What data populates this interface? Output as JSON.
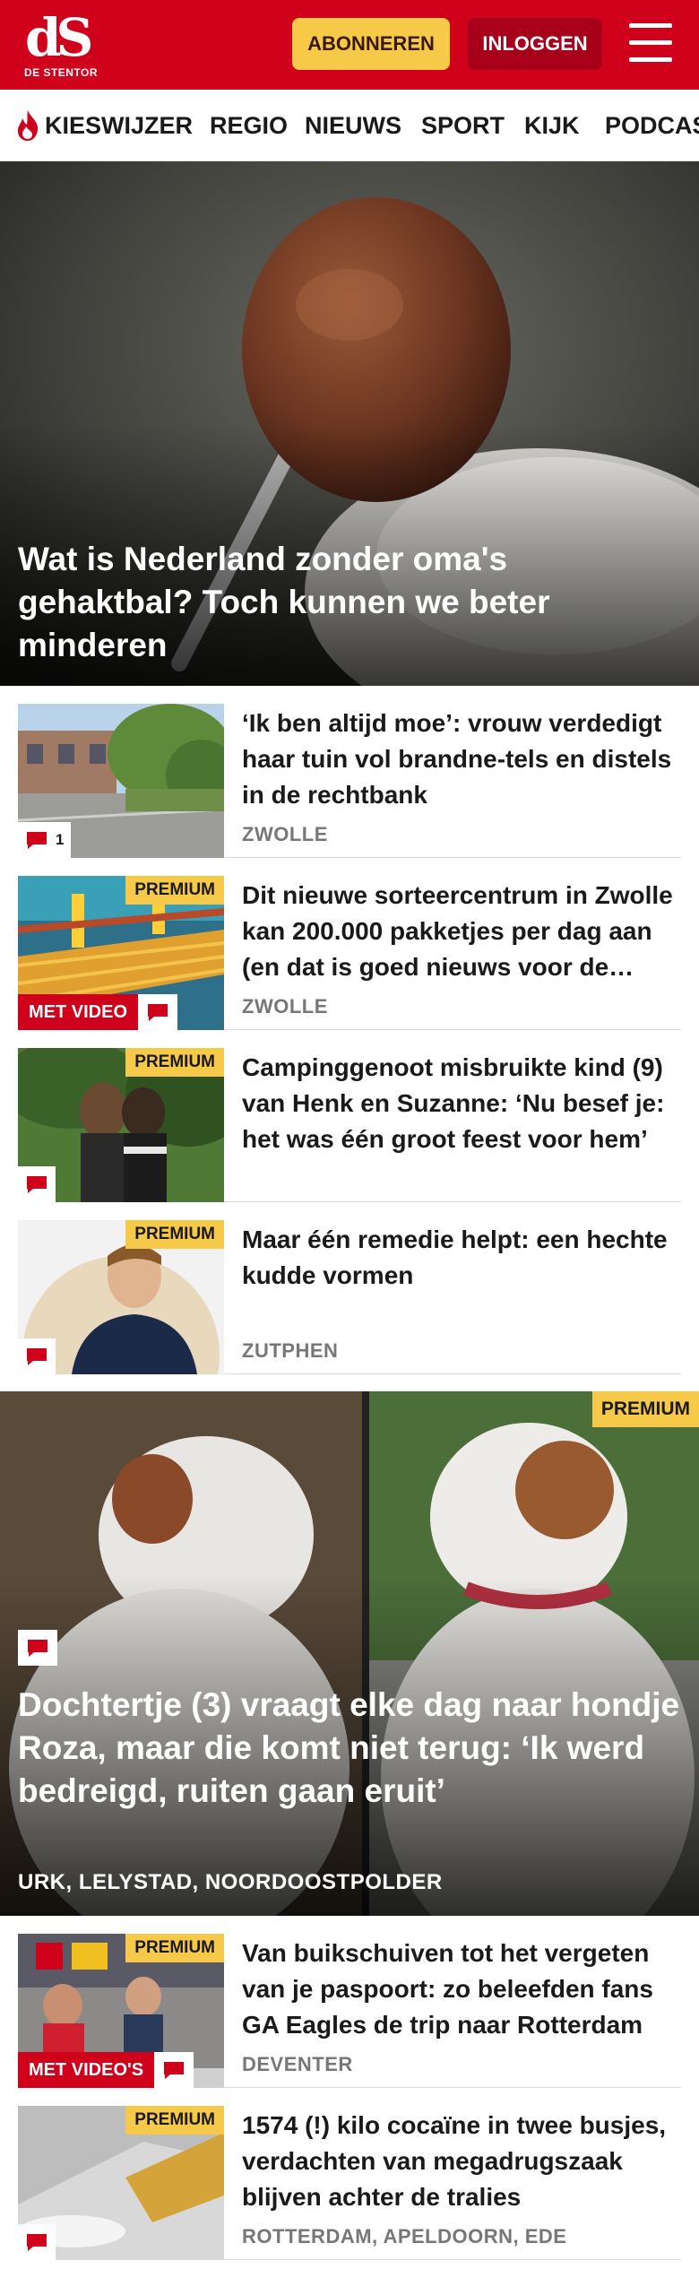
{
  "brand": {
    "logo_mark": "dS",
    "logo_sub": "DE STENTOR",
    "accent": "#d0021b",
    "premium_color": "#f7c948"
  },
  "header": {
    "subscribe_label": "ABONNEREN",
    "login_label": "INLOGGEN",
    "menu_icon": "hamburger-icon"
  },
  "nav": {
    "items": [
      "KIESWIJZER",
      "REGIO",
      "NIEUWS",
      "SPORT",
      "KIJK",
      "PODCAST"
    ]
  },
  "hero": {
    "title": "Wat is Nederland zonder oma's gehaktbal? Toch kunnen we beter minderen"
  },
  "articles_top": [
    {
      "title": "‘Ik ben altijd moe’: vrouw verdedigt haar tuin vol brandne-tels en distels in de rechtbank",
      "location": "ZWOLLE",
      "comment_count": "1",
      "premium": ""
    },
    {
      "title": "Dit nieuwe sorteercentrum in Zwolle kan 200.000 pakketjes per dag aan (en dat is goed nieuws voor de regio)",
      "location": "ZWOLLE",
      "premium": "PREMIUM",
      "video_label": "MET VIDEO"
    },
    {
      "title": "Campinggenoot misbruikte kind (9) van Henk en Suzanne: ‘Nu besef je: het was één groot feest voor hem’",
      "location": "",
      "premium": "PREMIUM"
    },
    {
      "title": "Maar één remedie helpt: een hechte kudde vormen",
      "location": "ZUTPHEN",
      "premium": "PREMIUM"
    }
  ],
  "feature": {
    "premium": "PREMIUM",
    "title": "Dochtertje (3) vraagt elke dag naar hondje Roza, maar die komt niet terug: ‘Ik werd bedreigd, ruiten gaan eruit’",
    "location": "URK, LELYSTAD, NOORDOOSTPOLDER"
  },
  "articles_bottom": [
    {
      "title": "Van buikschuiven tot het vergeten van je paspoort: zo beleefden fans GA Eagles de trip naar Rotterdam",
      "location": "DEVENTER",
      "premium": "PREMIUM",
      "video_label": "MET VIDEO'S"
    },
    {
      "title": "1574 (!) kilo cocaïne in twee busjes, verdachten van megadrugszaak blijven achter de tralies",
      "location": "ROTTERDAM, APELDOORN, EDE",
      "premium": "PREMIUM"
    }
  ]
}
